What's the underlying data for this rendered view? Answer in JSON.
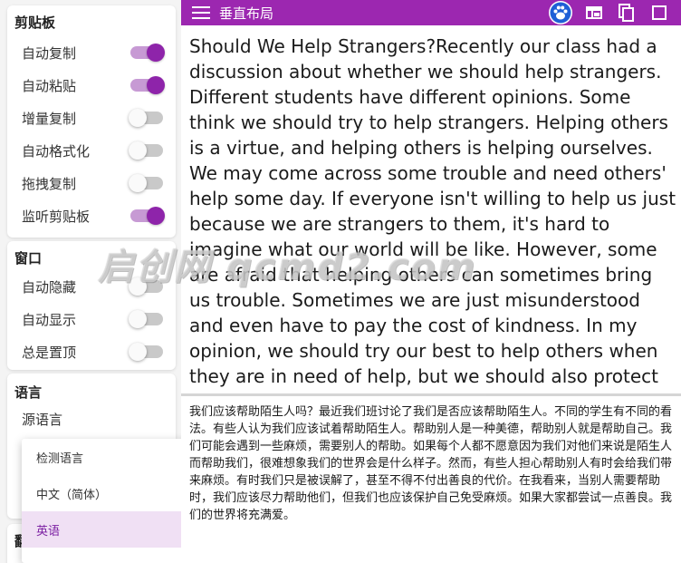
{
  "topbar": {
    "title": "垂直布局",
    "accent_color": "#9c27b0",
    "icons": [
      "menu-icon",
      "paw-icon",
      "grid-icon",
      "copy-icon",
      "square-icon"
    ]
  },
  "clipboard": {
    "title": "剪贴板",
    "items": [
      {
        "label": "自动复制",
        "on": true
      },
      {
        "label": "自动粘贴",
        "on": true
      },
      {
        "label": "增量复制",
        "on": false
      },
      {
        "label": "自动格式化",
        "on": false
      },
      {
        "label": "拖拽复制",
        "on": false
      },
      {
        "label": "监听剪贴板",
        "on": true
      }
    ]
  },
  "window": {
    "title": "窗口",
    "items": [
      {
        "label": "自动隐藏",
        "on": false
      },
      {
        "label": "自动显示",
        "on": false
      },
      {
        "label": "总是置顶",
        "on": false
      }
    ]
  },
  "language": {
    "title": "语言",
    "source_label": "源语言",
    "partial_label": "翻"
  },
  "dropdown": {
    "options": [
      "检测语言",
      "中文（简体）",
      "英语"
    ],
    "selected": "英语"
  },
  "source_text": "Should We Help Strangers?Recently our class had a discussion about whether we should help strangers. Different students have different opinions. Some think we should try to help strangers.  Helping others is a virtue, and helping others is helping ourselves. We may come across some trouble and need others' help some day. If everyone isn't willing to help us just because we are strangers to them, it's hard to imagine what our world will be like. However, some are afraid that helping others can sometimes bring us trouble. Sometimes we are just misunderstood and even have to pay the cost of kindness. In my opinion, we should try our best to help others when they are in need of help, but we should also protect ourselves from getting into trouble. If everyone tries a little kindness, our world will be full of love.",
  "target_text": "我们应该帮助陌生人吗？最近我们班讨论了我们是否应该帮助陌生人。不同的学生有不同的看法。有些人认为我们应该试着帮助陌生人。帮助别人是一种美德，帮助别人就是帮助自己。我们可能会遇到一些麻烦，需要别人的帮助。如果每个人都不愿意因为我们对他们来说是陌生人而帮助我们，很难想象我们的世界会是什么样子。然而，有些人担心帮助别人有时会给我们带来麻烦。有时我们只是被误解了，甚至不得不付出善良的代价。在我看来，当别人需要帮助时，我们应该尽力帮助他们，但我们也应该保护自己免受麻烦。如果大家都尝试一点善良。我们的世界将充满爱。",
  "watermark": "启创网 qcmd2.com"
}
